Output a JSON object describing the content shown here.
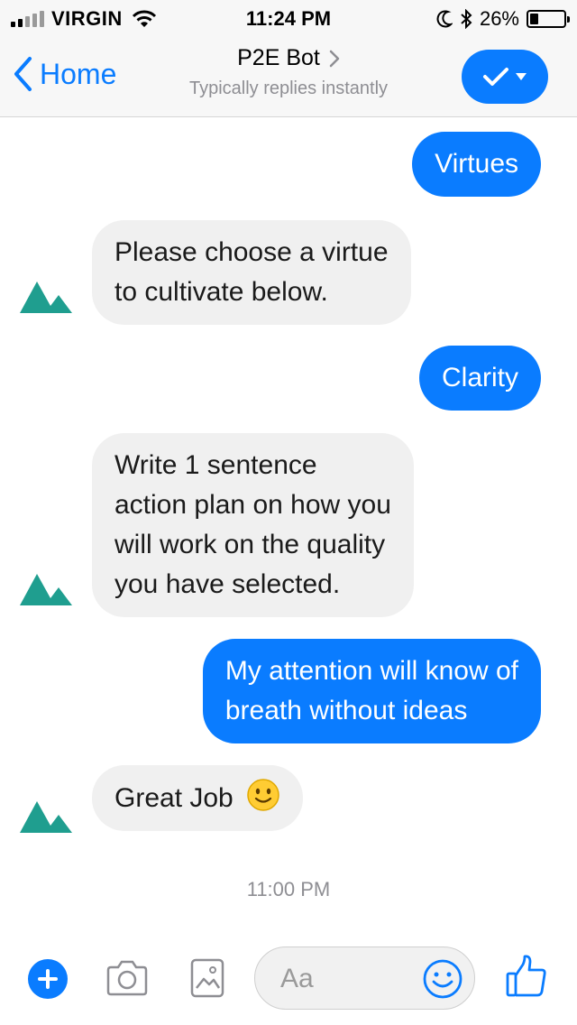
{
  "status_bar": {
    "carrier": "VIRGIN",
    "time": "11:24 PM",
    "battery": "26%",
    "battery_level": 0.26,
    "icons": [
      "signal-icon",
      "wifi-icon",
      "moon-icon",
      "bluetooth-icon",
      "battery-icon"
    ]
  },
  "header": {
    "back_label": "Home",
    "title": "P2E Bot",
    "subtitle": "Typically replies instantly",
    "icons": [
      "chevron-left-icon",
      "chevron-right-icon",
      "checkmark-icon",
      "caret-down-icon"
    ],
    "accent_color": "#0a7cff"
  },
  "messages": [
    {
      "from": "user",
      "text": "Virtues"
    },
    {
      "from": "bot",
      "lines": [
        "Please choose a virtue",
        "to cultivate below."
      ]
    },
    {
      "from": "user",
      "text": "Clarity"
    },
    {
      "from": "bot",
      "lines": [
        "Write 1 sentence",
        "action plan on how you",
        "will work on the quality",
        "you have selected."
      ]
    },
    {
      "from": "user",
      "lines": [
        "My attention will know of",
        "breath without ideas"
      ]
    },
    {
      "from": "bot",
      "text": "Great Job",
      "emoji": "slightly-smiling-face"
    }
  ],
  "timestamp": "11:00 PM",
  "composer": {
    "placeholder": "Aa",
    "icons": [
      "plus-icon",
      "camera-icon",
      "image-icon",
      "emoji-icon",
      "thumbs-up-icon"
    ]
  },
  "colors": {
    "outgoing_bubble": "#0a7cff",
    "incoming_bubble": "#f0f0f0",
    "bot_avatar": "#1f9e8f"
  }
}
